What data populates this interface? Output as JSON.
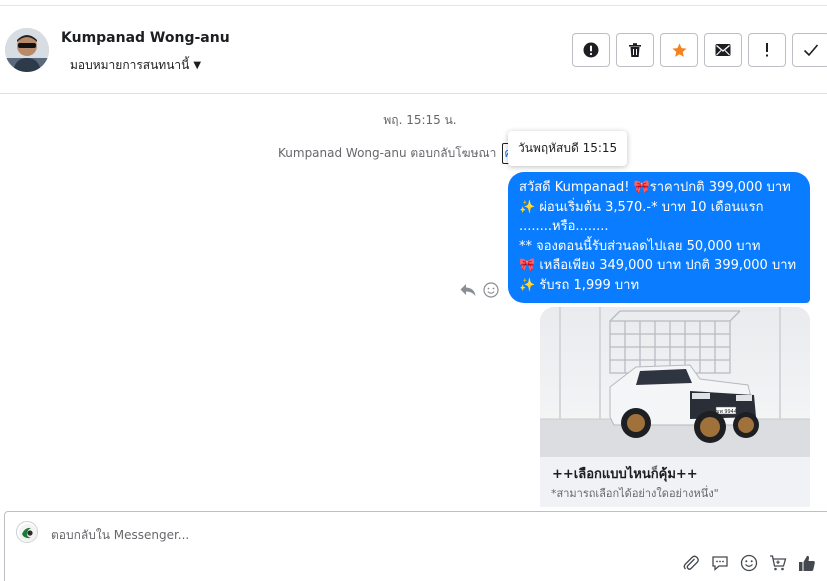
{
  "header": {
    "contact_name": "Kumpanad Wong-anu",
    "assign_label": "มอบหมายการสนทนานี้",
    "actions": [
      {
        "icon": "alert-circle-icon",
        "label": ""
      },
      {
        "icon": "trash-icon",
        "label": ""
      },
      {
        "icon": "star-icon",
        "label": ""
      },
      {
        "icon": "envelope-icon",
        "label": ""
      },
      {
        "icon": "exclamation-icon",
        "label": "!"
      },
      {
        "icon": "check-icon",
        "label": ""
      }
    ]
  },
  "thread": {
    "timestamp": "พฤ. 15:15 น.",
    "ad_reply_prefix": "Kumpanad Wong-anu ตอบกลับโฆษณา",
    "ad_link_text": "ค",
    "tooltip": "วันพฤหัสบดี 15:15",
    "message_lines": [
      "สวัสดี Kumpanad! ",
      "ราคาปกติ 399,000 บาท",
      " ผ่อนเริ่มต้น 3,570.-* บาท 10 เดือนแรก",
      "........หรือ........",
      "** จองตอนนี้รับส่วนลดไปเลย 50,000 บาท",
      " เหลือเพียง 349,000 บาท ปกติ 399,000 บาท",
      " รับรถ 1,999 บาท"
    ],
    "card": {
      "title": "++เลือกแบบไหนก็คุ้ม++",
      "subtitle": "*สามารถเลือกได้อย่างใดอย่างหนึ่ง\"",
      "plate": "ฒพ 9944"
    }
  },
  "composer": {
    "placeholder": "ตอบกลับใน Messenger..."
  },
  "colors": {
    "bubble": "#0a7cff",
    "star": "#f5821f",
    "link": "#1877f2"
  }
}
